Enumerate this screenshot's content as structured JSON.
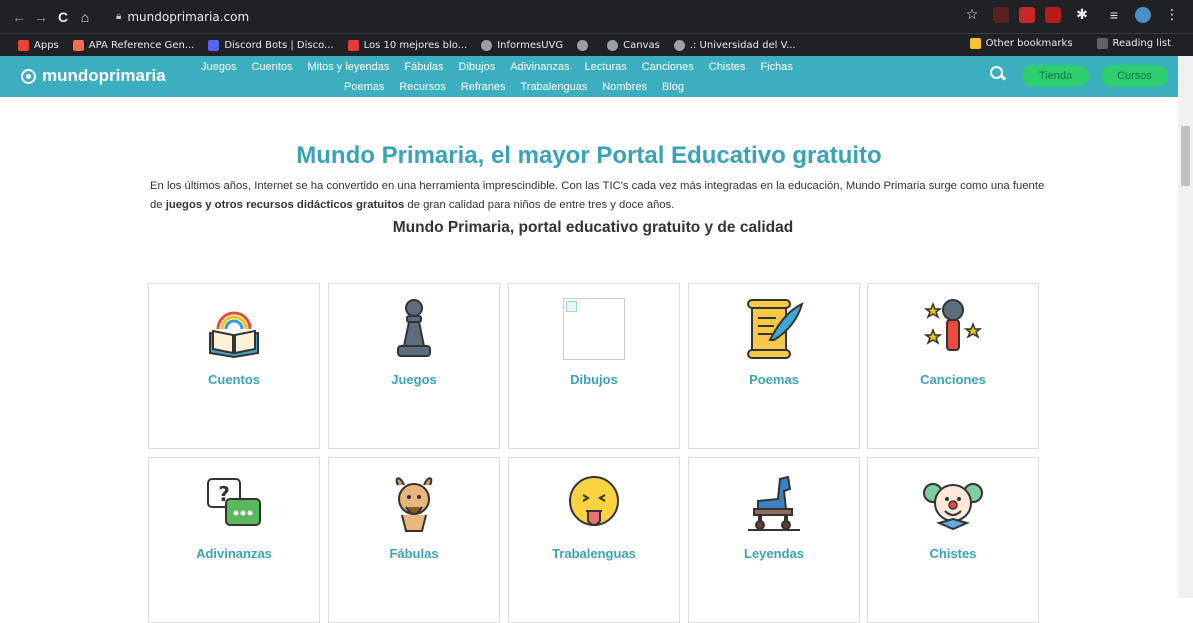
{
  "browser": {
    "url": "mundoprimaria.com",
    "bookmarks": [
      {
        "label": "Apps",
        "color": "#ea4335"
      },
      {
        "label": "APA Reference Gen...",
        "color": "#f06f4e"
      },
      {
        "label": "Discord Bots | Disco...",
        "color": "#5865f2"
      },
      {
        "label": "Los 10 mejores blo...",
        "color": "#e53935"
      },
      {
        "label": "InformesUVG",
        "color": "#9aa0a6"
      },
      {
        "label": "",
        "color": "#9aa0a6"
      },
      {
        "label": "Canvas",
        "color": "#9aa0a6"
      },
      {
        "label": ".: Universidad del V...",
        "color": "#9aa0a6"
      }
    ],
    "other_bookmarks": "Other bookmarks",
    "reading_list": "Reading list"
  },
  "site": {
    "logo": "mundoprimaria",
    "nav_row1": [
      "Juegos",
      "Cuentos",
      "Mitos y leyendas",
      "Fábulas",
      "Dibujos",
      "Adivinanzas",
      "Lecturas",
      "Canciones",
      "Chistes",
      "Fichas"
    ],
    "nav_row2": [
      "Poemas",
      "Recursos",
      "Refranes",
      "Trabalenguas",
      "Nombres",
      "Blog"
    ],
    "tienda": "Tienda",
    "cursos": "Cursos"
  },
  "main": {
    "title": "Mundo Primaria, el mayor Portal Educativo gratuito",
    "intro_part1": "En los últimos años, Internet se ha convertido en una herramienta imprescindible. Con las TIC's cada vez más integradas en la educación, Mundo Primaria surge como una fuente de ",
    "intro_bold": "juegos y otros recursos didácticos gratuitos",
    "intro_part2": " de gran calidad para niños de entre tres y doce años.",
    "subtitle": "Mundo Primaria, portal educativo gratuito y de calidad",
    "cards": [
      {
        "label": "Cuentos",
        "icon": "book-rainbow-icon"
      },
      {
        "label": "Juegos",
        "icon": "chess-pawn-icon"
      },
      {
        "label": "Dibujos",
        "icon": "broken-image-icon"
      },
      {
        "label": "Poemas",
        "icon": "scroll-quill-icon"
      },
      {
        "label": "Canciones",
        "icon": "microphone-stars-icon"
      },
      {
        "label": "Adivinanzas",
        "icon": "question-bubbles-icon"
      },
      {
        "label": "Fábulas",
        "icon": "faun-icon"
      },
      {
        "label": "Trabalenguas",
        "icon": "tongue-face-icon"
      },
      {
        "label": "Leyendas",
        "icon": "trojan-horse-icon"
      },
      {
        "label": "Chistes",
        "icon": "clown-icon"
      }
    ]
  }
}
